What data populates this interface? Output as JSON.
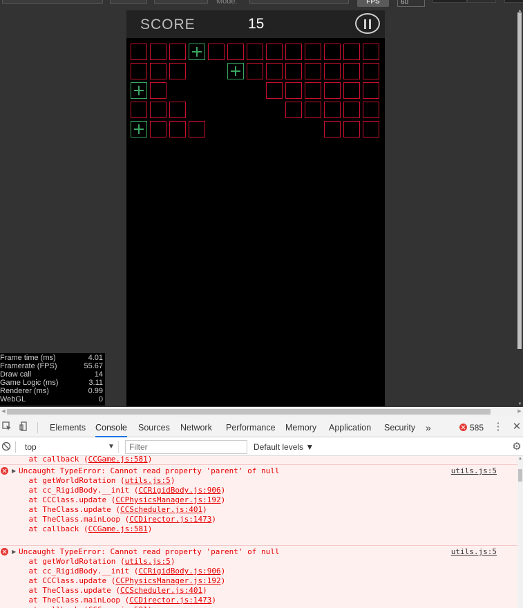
{
  "toolbar": {
    "mode_label": "Mode:",
    "fps_button": "FPS",
    "fps_value": "60"
  },
  "game": {
    "score_label": "SCORE",
    "score_value": "15",
    "colors": {
      "red": "#c8102e",
      "green": "#3aa661"
    },
    "grid_rows": [
      "rrrgrrrrrrrrr",
      "rrr..grrrrrrr",
      "gr.....rrrrrr",
      "rrr.....rrrrr",
      "grrr......rrr"
    ]
  },
  "stats": [
    {
      "label": "Frame time (ms)",
      "value": "4.01"
    },
    {
      "label": "Framerate (FPS)",
      "value": "55.67"
    },
    {
      "label": "Draw call",
      "value": "14"
    },
    {
      "label": "Game Logic (ms)",
      "value": "3.11"
    },
    {
      "label": "Renderer (ms)",
      "value": "0.99"
    },
    {
      "label": "WebGL",
      "value": "0"
    }
  ],
  "devtools": {
    "tabs": [
      "Elements",
      "Console",
      "Sources",
      "Network",
      "Performance",
      "Memory",
      "Application",
      "Security"
    ],
    "active_tab": "Console",
    "more": "»",
    "error_count": "585",
    "context": "top",
    "filter_placeholder": "Filter",
    "levels": "Default levels ▼"
  },
  "console": {
    "partial_line": "    at callback (CCGame.js:581)",
    "errors": [
      {
        "message": "Uncaught TypeError: Cannot read property 'parent' of null",
        "source": "utils.js:5",
        "stack": [
          "    at getWorldRotation (utils.js:5)",
          "    at cc_RigidBody.__init (CCRigidBody.js:906)",
          "    at CCClass.update (CCPhysicsManager.js:192)",
          "    at TheClass.update (CCScheduler.js:401)",
          "    at TheClass.mainLoop (CCDirector.js:1473)",
          "    at callback (CCGame.js:581)"
        ]
      },
      {
        "message": "Uncaught TypeError: Cannot read property 'parent' of null",
        "source": "utils.js:5",
        "stack": [
          "    at getWorldRotation (utils.js:5)",
          "    at cc_RigidBody.__init (CCRigidBody.js:906)",
          "    at CCClass.update (CCPhysicsManager.js:192)",
          "    at TheClass.update (CCScheduler.js:401)",
          "    at TheClass.mainLoop (CCDirector.js:1473)",
          "    at callback (CCGame.js:581)"
        ]
      }
    ]
  }
}
